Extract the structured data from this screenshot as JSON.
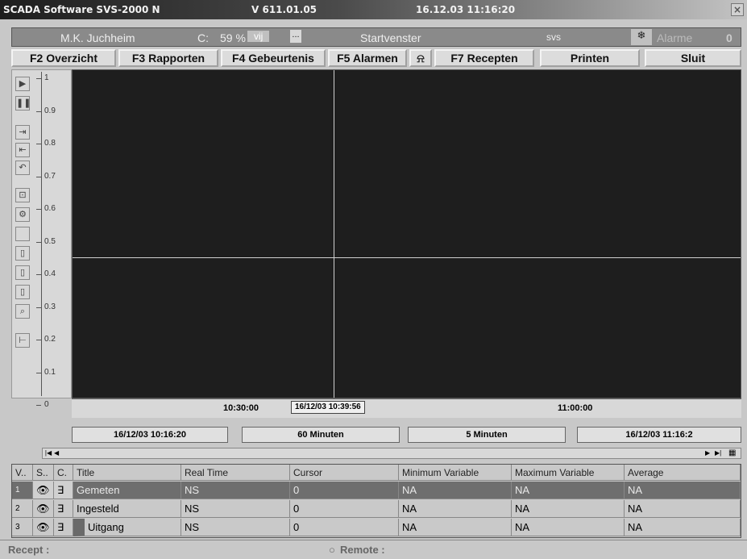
{
  "titlebar": {
    "app": "SCADA Software  SVS-2000 N",
    "version": "V 611.01.05",
    "datetime": "16.12.03 11:16:20",
    "close": "×"
  },
  "infobar": {
    "user": "M.K. Juchheim",
    "c_label": "C:",
    "percent": "59 %",
    "vrij": "vij",
    "ellipsis": "...",
    "window": "Startvenster",
    "svs": "svs",
    "alarms_label": "Alarme",
    "alarms_count": "0"
  },
  "toolbar": {
    "f2": "F2  Overzicht",
    "f3": "F3  Rapporten",
    "f4": "F4  Gebeurtenis",
    "f5": "F5  Alarmen",
    "f7": "F7  Recepten",
    "print": "Printen",
    "close": "Sluit"
  },
  "chart_data": {
    "type": "line",
    "y_ticks": [
      "1",
      "0.9",
      "0.8",
      "0.7",
      "0.6",
      "0.5",
      "0.4",
      "0.3",
      "0.2",
      "0.1",
      "0"
    ],
    "ylim": [
      0,
      1
    ],
    "time_labels": [
      "10:30:00",
      "11:00:00"
    ],
    "cursor_time": "16/12/03 10:39:56",
    "series": []
  },
  "timebar": {
    "start": "16/12/03 10:16:20",
    "span": "60 Minuten",
    "step": "5 Minuten",
    "end": "16/12/03 11:16:2"
  },
  "table": {
    "headers": [
      "V..",
      "S..",
      "C.",
      "Title",
      "Real Time",
      "Cursor",
      "Minimum Variable",
      "Maximum Variable",
      "Average"
    ],
    "rows": [
      {
        "num": "1",
        "title": "Gemeten",
        "realtime": "NS",
        "cursor": "0",
        "min": "NA",
        "max": "NA",
        "avg": "NA"
      },
      {
        "num": "2",
        "title": "Ingesteld",
        "realtime": "NS",
        "cursor": "0",
        "min": "NA",
        "max": "NA",
        "avg": "NA"
      },
      {
        "num": "3",
        "title": "Uitgang",
        "realtime": "NS",
        "cursor": "0",
        "min": "NA",
        "max": "NA",
        "avg": "NA"
      }
    ]
  },
  "status": {
    "recept": "Recept :",
    "remote": "Remote :"
  }
}
